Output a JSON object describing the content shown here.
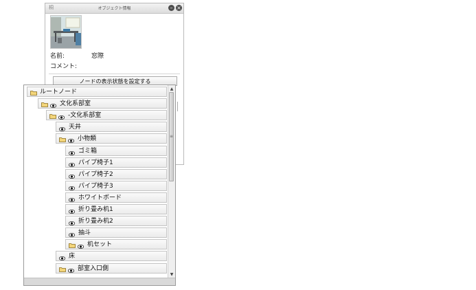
{
  "panel": {
    "corner_label": "桐",
    "title": "オブジェクト情報",
    "name_label": "名前:",
    "name_value": "窓際",
    "comment_label": "コメント:",
    "set_visibility_button": "ノードの表示状態を設定する"
  },
  "tree": {
    "nodes": [
      {
        "label": "ルートノード",
        "folder": true,
        "eye": false,
        "level": 0
      },
      {
        "label": "文化系部室",
        "folder": true,
        "eye": true,
        "level": 1
      },
      {
        "label": "-文化系部室",
        "folder": true,
        "eye": true,
        "level": 2
      },
      {
        "label": "天井",
        "folder": false,
        "eye": true,
        "level": 3
      },
      {
        "label": "小物類",
        "folder": true,
        "eye": true,
        "level": 3
      },
      {
        "label": "ゴミ箱",
        "folder": false,
        "eye": true,
        "level": 4
      },
      {
        "label": "パイプ椅子1",
        "folder": false,
        "eye": true,
        "level": 4
      },
      {
        "label": "パイプ椅子2",
        "folder": false,
        "eye": true,
        "level": 4
      },
      {
        "label": "パイプ椅子3",
        "folder": false,
        "eye": true,
        "level": 4
      },
      {
        "label": "ホワイトボード",
        "folder": false,
        "eye": true,
        "level": 4
      },
      {
        "label": "折り畳み机1",
        "folder": false,
        "eye": true,
        "level": 4
      },
      {
        "label": "折り畳み机2",
        "folder": false,
        "eye": true,
        "level": 4
      },
      {
        "label": "抽斗",
        "folder": false,
        "eye": true,
        "level": 4
      },
      {
        "label": "机セット",
        "folder": true,
        "eye": true,
        "level": 4
      },
      {
        "label": "床",
        "folder": false,
        "eye": true,
        "level": 3
      },
      {
        "label": "部室入口側",
        "folder": true,
        "eye": true,
        "level": 3
      }
    ]
  }
}
